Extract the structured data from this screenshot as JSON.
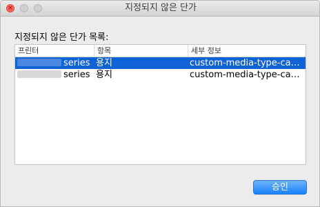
{
  "window": {
    "title": "지정되지 않은 단가",
    "close_glyph": "×"
  },
  "content": {
    "list_label": "지정되지 않은 단가 목록:"
  },
  "table": {
    "columns": [
      "프린터",
      "항목",
      "세부 정보"
    ],
    "rows": [
      {
        "printer": "series",
        "item": "용지",
        "details": "custom-media-type-canon-...",
        "selected": true
      },
      {
        "printer": "series",
        "item": "용지",
        "details": "custom-media-type-canon-...",
        "selected": false
      }
    ]
  },
  "buttons": {
    "approve_label": "승인"
  },
  "colors": {
    "selection": "#0f63d6",
    "button": "#1a82fb",
    "close_light": "#fc605b"
  }
}
